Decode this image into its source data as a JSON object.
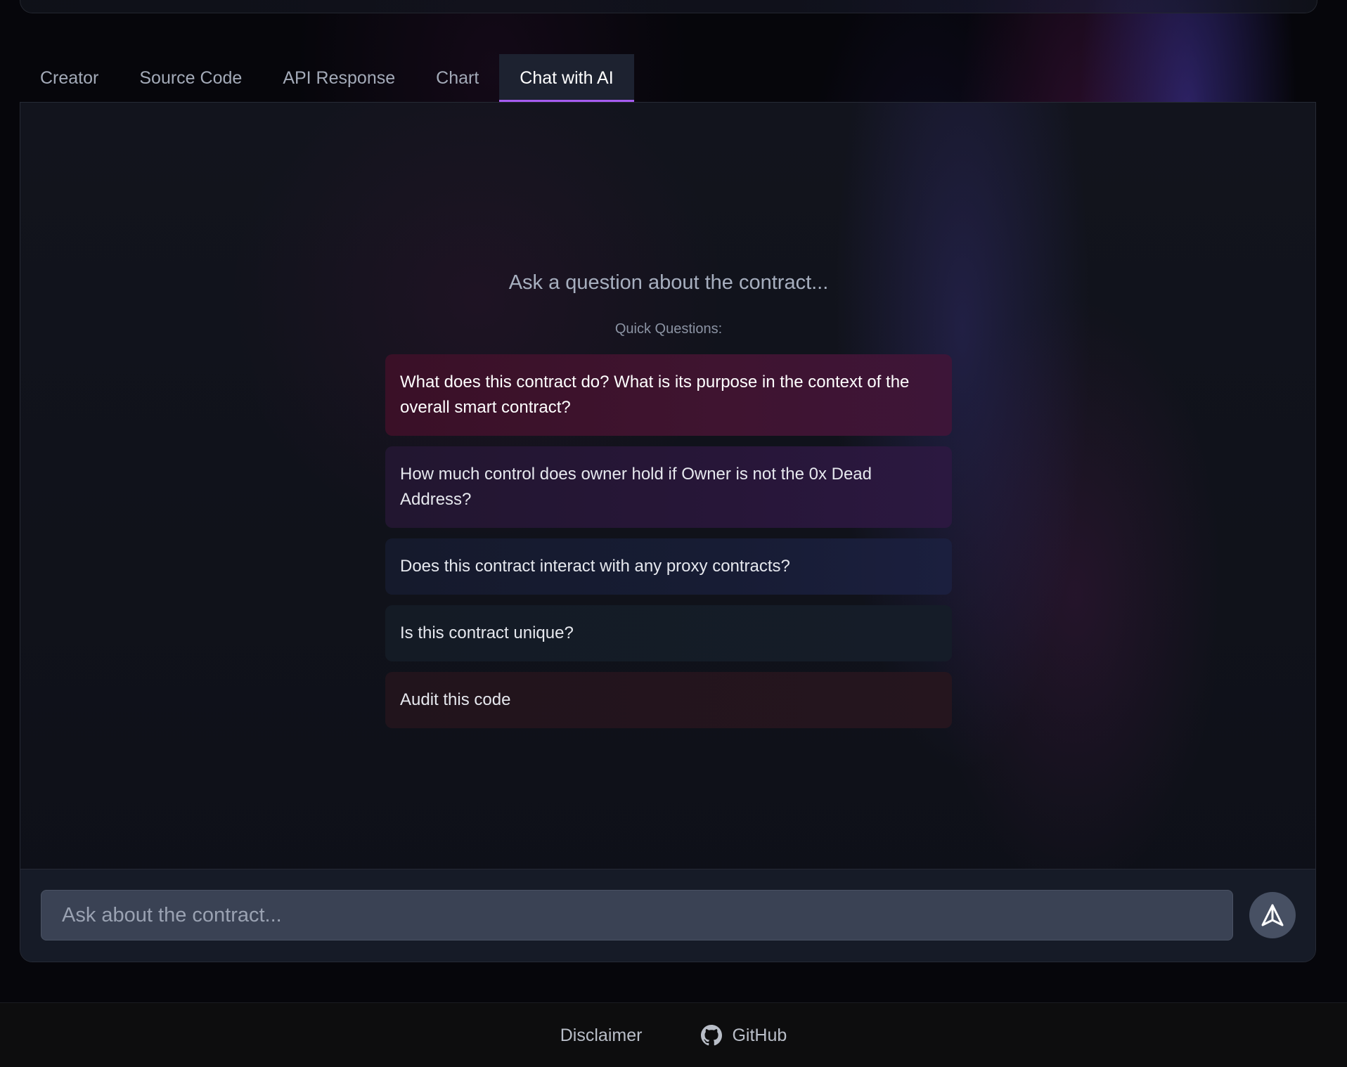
{
  "tabs": [
    {
      "label": "Creator",
      "active": false
    },
    {
      "label": "Source Code",
      "active": false
    },
    {
      "label": "API Response",
      "active": false
    },
    {
      "label": "Chart",
      "active": false
    },
    {
      "label": "Chat with AI",
      "active": true
    }
  ],
  "chat": {
    "prompt": "Ask a question about the contract...",
    "quick_label": "Quick Questions:",
    "questions": [
      "What does this contract do? What is its purpose in the context of the overall smart contract?",
      "How much control does owner hold if Owner is not the 0x Dead Address?",
      "Does this contract interact with any proxy contracts?",
      "Is this contract unique?",
      "Audit this code"
    ],
    "input_placeholder": "Ask about the contract...",
    "send_icon": "send-icon"
  },
  "footer": {
    "disclaimer": "Disclaimer",
    "github": "GitHub",
    "github_icon": "github-icon"
  },
  "colors": {
    "accent": "#a65cf0",
    "panel_bg": "#12141d",
    "input_bg": "#3a4254"
  }
}
